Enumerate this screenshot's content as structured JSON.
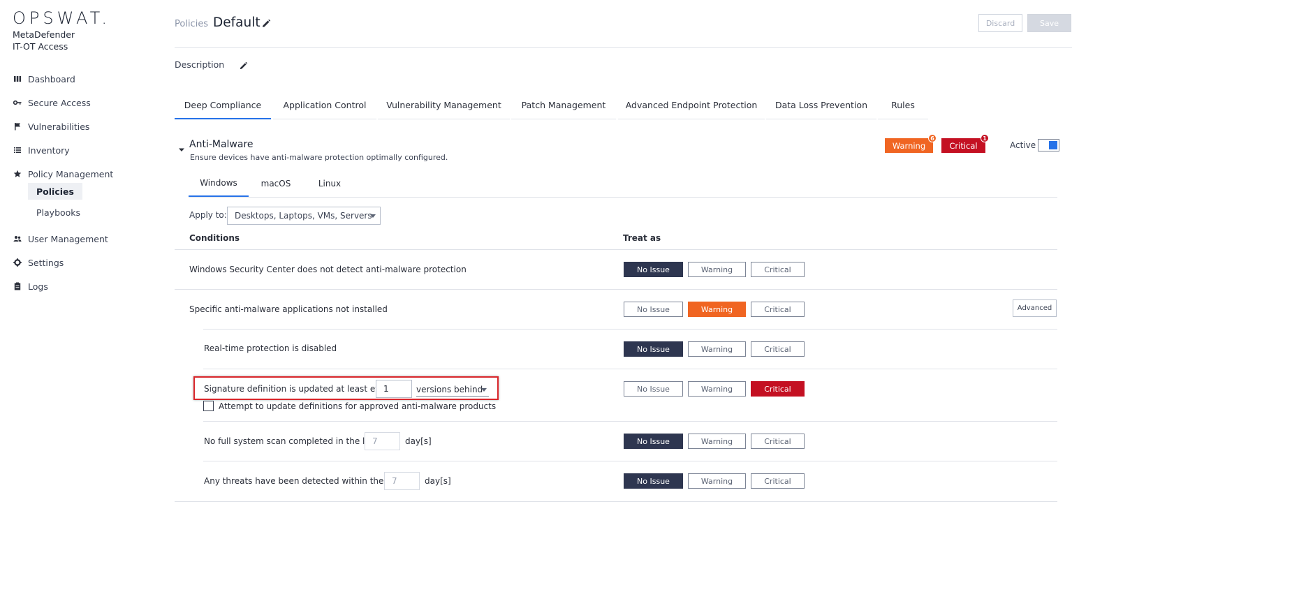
{
  "brand": {
    "logo": "OPSWAT.",
    "product_line1": "MetaDefender",
    "product_line2": "IT-OT Access",
    "accent": "#2672e8"
  },
  "sidebar": {
    "items": [
      {
        "label": "Dashboard",
        "icon": "bar-chart-icon"
      },
      {
        "label": "Secure Access",
        "icon": "key-icon"
      },
      {
        "label": "Vulnerabilities",
        "icon": "flag-icon"
      },
      {
        "label": "Inventory",
        "icon": "list-icon"
      },
      {
        "label": "Policy Management",
        "icon": "star-icon"
      },
      {
        "label": "User Management",
        "icon": "users-icon"
      },
      {
        "label": "Settings",
        "icon": "gear-icon"
      },
      {
        "label": "Logs",
        "icon": "clipboard-icon"
      }
    ],
    "sub_items": [
      {
        "label": "Policies",
        "active": true
      },
      {
        "label": "Playbooks",
        "active": false
      }
    ]
  },
  "header": {
    "breadcrumb": "Policies",
    "title": "Default",
    "discard_label": "Discard",
    "save_label": "Save",
    "description_label": "Description"
  },
  "tabs": [
    {
      "label": "Deep Compliance",
      "active": true
    },
    {
      "label": "Application Control",
      "active": false
    },
    {
      "label": "Vulnerability Management",
      "active": false
    },
    {
      "label": "Patch Management",
      "active": false
    },
    {
      "label": "Advanced Endpoint Protection",
      "active": false
    },
    {
      "label": "Data Loss Prevention",
      "active": false
    },
    {
      "label": "Rules",
      "active": false
    }
  ],
  "section": {
    "title": "Anti-Malware",
    "description": "Ensure devices have anti-malware protection optimally configured.",
    "warning_label": "Warning",
    "warning_count": "6",
    "critical_label": "Critical",
    "critical_count": "1",
    "active_label": "Active",
    "active": true,
    "warning_color": "#f06522",
    "critical_color": "#c41022",
    "no_issue_color": "#2e3650"
  },
  "os_tabs": [
    {
      "label": "Windows",
      "active": true
    },
    {
      "label": "macOS",
      "active": false
    },
    {
      "label": "Linux",
      "active": false
    }
  ],
  "apply": {
    "label": "Apply to:",
    "value": "Desktops, Laptops, VMs, Servers"
  },
  "columns": {
    "conditions": "Conditions",
    "treat_as": "Treat as"
  },
  "options": {
    "no_issue": "No Issue",
    "warning": "Warning",
    "critical": "Critical"
  },
  "advanced_label": "Advanced",
  "conditions": [
    {
      "text": "Windows Security Center does not detect anti-malware protection",
      "treat": "no_issue"
    },
    {
      "text": "Specific anti-malware applications not installed",
      "treat": "warning"
    },
    {
      "text": "Real-time protection is disabled",
      "treat": "no_issue"
    },
    {
      "text": "Signature definition is updated at least every",
      "value": "1",
      "unit": "versions behind",
      "treat": "critical",
      "checkbox_label": "Attempt to update definitions for approved anti-malware products",
      "checkbox_checked": false
    },
    {
      "text": "No full system scan completed in the last",
      "value": "7",
      "unit": "day[s]",
      "treat": "no_issue"
    },
    {
      "text": "Any threats have been detected within the last",
      "value": "7",
      "unit": "day[s]",
      "treat": "no_issue"
    }
  ]
}
